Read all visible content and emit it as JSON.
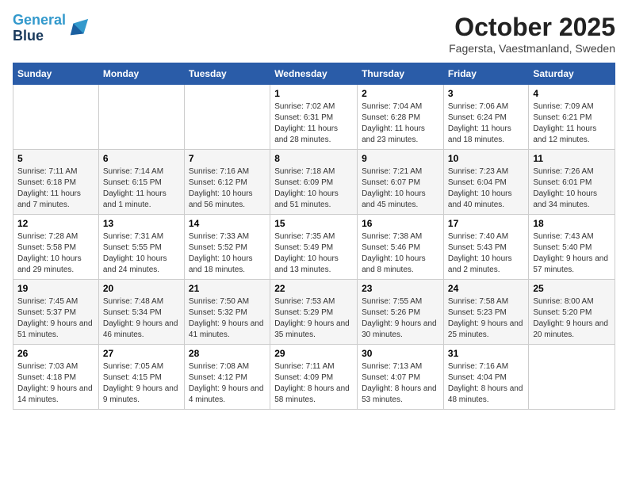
{
  "header": {
    "logo_line1": "General",
    "logo_line2": "Blue",
    "title": "October 2025",
    "subtitle": "Fagersta, Vaestmanland, Sweden"
  },
  "columns": [
    "Sunday",
    "Monday",
    "Tuesday",
    "Wednesday",
    "Thursday",
    "Friday",
    "Saturday"
  ],
  "weeks": [
    [
      {
        "day": "",
        "info": ""
      },
      {
        "day": "",
        "info": ""
      },
      {
        "day": "",
        "info": ""
      },
      {
        "day": "1",
        "info": "Sunrise: 7:02 AM\nSunset: 6:31 PM\nDaylight: 11 hours and 28 minutes."
      },
      {
        "day": "2",
        "info": "Sunrise: 7:04 AM\nSunset: 6:28 PM\nDaylight: 11 hours and 23 minutes."
      },
      {
        "day": "3",
        "info": "Sunrise: 7:06 AM\nSunset: 6:24 PM\nDaylight: 11 hours and 18 minutes."
      },
      {
        "day": "4",
        "info": "Sunrise: 7:09 AM\nSunset: 6:21 PM\nDaylight: 11 hours and 12 minutes."
      }
    ],
    [
      {
        "day": "5",
        "info": "Sunrise: 7:11 AM\nSunset: 6:18 PM\nDaylight: 11 hours and 7 minutes."
      },
      {
        "day": "6",
        "info": "Sunrise: 7:14 AM\nSunset: 6:15 PM\nDaylight: 11 hours and 1 minute."
      },
      {
        "day": "7",
        "info": "Sunrise: 7:16 AM\nSunset: 6:12 PM\nDaylight: 10 hours and 56 minutes."
      },
      {
        "day": "8",
        "info": "Sunrise: 7:18 AM\nSunset: 6:09 PM\nDaylight: 10 hours and 51 minutes."
      },
      {
        "day": "9",
        "info": "Sunrise: 7:21 AM\nSunset: 6:07 PM\nDaylight: 10 hours and 45 minutes."
      },
      {
        "day": "10",
        "info": "Sunrise: 7:23 AM\nSunset: 6:04 PM\nDaylight: 10 hours and 40 minutes."
      },
      {
        "day": "11",
        "info": "Sunrise: 7:26 AM\nSunset: 6:01 PM\nDaylight: 10 hours and 34 minutes."
      }
    ],
    [
      {
        "day": "12",
        "info": "Sunrise: 7:28 AM\nSunset: 5:58 PM\nDaylight: 10 hours and 29 minutes."
      },
      {
        "day": "13",
        "info": "Sunrise: 7:31 AM\nSunset: 5:55 PM\nDaylight: 10 hours and 24 minutes."
      },
      {
        "day": "14",
        "info": "Sunrise: 7:33 AM\nSunset: 5:52 PM\nDaylight: 10 hours and 18 minutes."
      },
      {
        "day": "15",
        "info": "Sunrise: 7:35 AM\nSunset: 5:49 PM\nDaylight: 10 hours and 13 minutes."
      },
      {
        "day": "16",
        "info": "Sunrise: 7:38 AM\nSunset: 5:46 PM\nDaylight: 10 hours and 8 minutes."
      },
      {
        "day": "17",
        "info": "Sunrise: 7:40 AM\nSunset: 5:43 PM\nDaylight: 10 hours and 2 minutes."
      },
      {
        "day": "18",
        "info": "Sunrise: 7:43 AM\nSunset: 5:40 PM\nDaylight: 9 hours and 57 minutes."
      }
    ],
    [
      {
        "day": "19",
        "info": "Sunrise: 7:45 AM\nSunset: 5:37 PM\nDaylight: 9 hours and 51 minutes."
      },
      {
        "day": "20",
        "info": "Sunrise: 7:48 AM\nSunset: 5:34 PM\nDaylight: 9 hours and 46 minutes."
      },
      {
        "day": "21",
        "info": "Sunrise: 7:50 AM\nSunset: 5:32 PM\nDaylight: 9 hours and 41 minutes."
      },
      {
        "day": "22",
        "info": "Sunrise: 7:53 AM\nSunset: 5:29 PM\nDaylight: 9 hours and 35 minutes."
      },
      {
        "day": "23",
        "info": "Sunrise: 7:55 AM\nSunset: 5:26 PM\nDaylight: 9 hours and 30 minutes."
      },
      {
        "day": "24",
        "info": "Sunrise: 7:58 AM\nSunset: 5:23 PM\nDaylight: 9 hours and 25 minutes."
      },
      {
        "day": "25",
        "info": "Sunrise: 8:00 AM\nSunset: 5:20 PM\nDaylight: 9 hours and 20 minutes."
      }
    ],
    [
      {
        "day": "26",
        "info": "Sunrise: 7:03 AM\nSunset: 4:18 PM\nDaylight: 9 hours and 14 minutes."
      },
      {
        "day": "27",
        "info": "Sunrise: 7:05 AM\nSunset: 4:15 PM\nDaylight: 9 hours and 9 minutes."
      },
      {
        "day": "28",
        "info": "Sunrise: 7:08 AM\nSunset: 4:12 PM\nDaylight: 9 hours and 4 minutes."
      },
      {
        "day": "29",
        "info": "Sunrise: 7:11 AM\nSunset: 4:09 PM\nDaylight: 8 hours and 58 minutes."
      },
      {
        "day": "30",
        "info": "Sunrise: 7:13 AM\nSunset: 4:07 PM\nDaylight: 8 hours and 53 minutes."
      },
      {
        "day": "31",
        "info": "Sunrise: 7:16 AM\nSunset: 4:04 PM\nDaylight: 8 hours and 48 minutes."
      },
      {
        "day": "",
        "info": ""
      }
    ]
  ]
}
